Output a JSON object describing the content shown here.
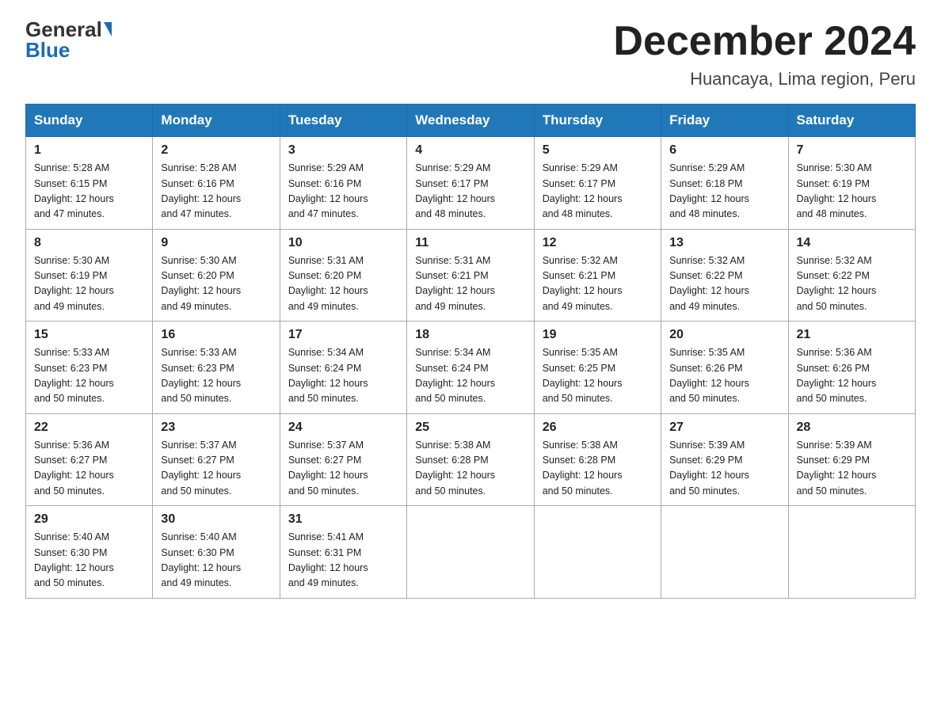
{
  "logo": {
    "general": "General",
    "blue": "Blue"
  },
  "title": "December 2024",
  "subtitle": "Huancaya, Lima region, Peru",
  "days_of_week": [
    "Sunday",
    "Monday",
    "Tuesday",
    "Wednesday",
    "Thursday",
    "Friday",
    "Saturday"
  ],
  "weeks": [
    [
      {
        "day": "1",
        "sunrise": "5:28 AM",
        "sunset": "6:15 PM",
        "daylight": "12 hours and 47 minutes."
      },
      {
        "day": "2",
        "sunrise": "5:28 AM",
        "sunset": "6:16 PM",
        "daylight": "12 hours and 47 minutes."
      },
      {
        "day": "3",
        "sunrise": "5:29 AM",
        "sunset": "6:16 PM",
        "daylight": "12 hours and 47 minutes."
      },
      {
        "day": "4",
        "sunrise": "5:29 AM",
        "sunset": "6:17 PM",
        "daylight": "12 hours and 48 minutes."
      },
      {
        "day": "5",
        "sunrise": "5:29 AM",
        "sunset": "6:17 PM",
        "daylight": "12 hours and 48 minutes."
      },
      {
        "day": "6",
        "sunrise": "5:29 AM",
        "sunset": "6:18 PM",
        "daylight": "12 hours and 48 minutes."
      },
      {
        "day": "7",
        "sunrise": "5:30 AM",
        "sunset": "6:19 PM",
        "daylight": "12 hours and 48 minutes."
      }
    ],
    [
      {
        "day": "8",
        "sunrise": "5:30 AM",
        "sunset": "6:19 PM",
        "daylight": "12 hours and 49 minutes."
      },
      {
        "day": "9",
        "sunrise": "5:30 AM",
        "sunset": "6:20 PM",
        "daylight": "12 hours and 49 minutes."
      },
      {
        "day": "10",
        "sunrise": "5:31 AM",
        "sunset": "6:20 PM",
        "daylight": "12 hours and 49 minutes."
      },
      {
        "day": "11",
        "sunrise": "5:31 AM",
        "sunset": "6:21 PM",
        "daylight": "12 hours and 49 minutes."
      },
      {
        "day": "12",
        "sunrise": "5:32 AM",
        "sunset": "6:21 PM",
        "daylight": "12 hours and 49 minutes."
      },
      {
        "day": "13",
        "sunrise": "5:32 AM",
        "sunset": "6:22 PM",
        "daylight": "12 hours and 49 minutes."
      },
      {
        "day": "14",
        "sunrise": "5:32 AM",
        "sunset": "6:22 PM",
        "daylight": "12 hours and 50 minutes."
      }
    ],
    [
      {
        "day": "15",
        "sunrise": "5:33 AM",
        "sunset": "6:23 PM",
        "daylight": "12 hours and 50 minutes."
      },
      {
        "day": "16",
        "sunrise": "5:33 AM",
        "sunset": "6:23 PM",
        "daylight": "12 hours and 50 minutes."
      },
      {
        "day": "17",
        "sunrise": "5:34 AM",
        "sunset": "6:24 PM",
        "daylight": "12 hours and 50 minutes."
      },
      {
        "day": "18",
        "sunrise": "5:34 AM",
        "sunset": "6:24 PM",
        "daylight": "12 hours and 50 minutes."
      },
      {
        "day": "19",
        "sunrise": "5:35 AM",
        "sunset": "6:25 PM",
        "daylight": "12 hours and 50 minutes."
      },
      {
        "day": "20",
        "sunrise": "5:35 AM",
        "sunset": "6:26 PM",
        "daylight": "12 hours and 50 minutes."
      },
      {
        "day": "21",
        "sunrise": "5:36 AM",
        "sunset": "6:26 PM",
        "daylight": "12 hours and 50 minutes."
      }
    ],
    [
      {
        "day": "22",
        "sunrise": "5:36 AM",
        "sunset": "6:27 PM",
        "daylight": "12 hours and 50 minutes."
      },
      {
        "day": "23",
        "sunrise": "5:37 AM",
        "sunset": "6:27 PM",
        "daylight": "12 hours and 50 minutes."
      },
      {
        "day": "24",
        "sunrise": "5:37 AM",
        "sunset": "6:27 PM",
        "daylight": "12 hours and 50 minutes."
      },
      {
        "day": "25",
        "sunrise": "5:38 AM",
        "sunset": "6:28 PM",
        "daylight": "12 hours and 50 minutes."
      },
      {
        "day": "26",
        "sunrise": "5:38 AM",
        "sunset": "6:28 PM",
        "daylight": "12 hours and 50 minutes."
      },
      {
        "day": "27",
        "sunrise": "5:39 AM",
        "sunset": "6:29 PM",
        "daylight": "12 hours and 50 minutes."
      },
      {
        "day": "28",
        "sunrise": "5:39 AM",
        "sunset": "6:29 PM",
        "daylight": "12 hours and 50 minutes."
      }
    ],
    [
      {
        "day": "29",
        "sunrise": "5:40 AM",
        "sunset": "6:30 PM",
        "daylight": "12 hours and 50 minutes."
      },
      {
        "day": "30",
        "sunrise": "5:40 AM",
        "sunset": "6:30 PM",
        "daylight": "12 hours and 49 minutes."
      },
      {
        "day": "31",
        "sunrise": "5:41 AM",
        "sunset": "6:31 PM",
        "daylight": "12 hours and 49 minutes."
      },
      null,
      null,
      null,
      null
    ]
  ],
  "labels": {
    "sunrise": "Sunrise:",
    "sunset": "Sunset:",
    "daylight": "Daylight:"
  }
}
